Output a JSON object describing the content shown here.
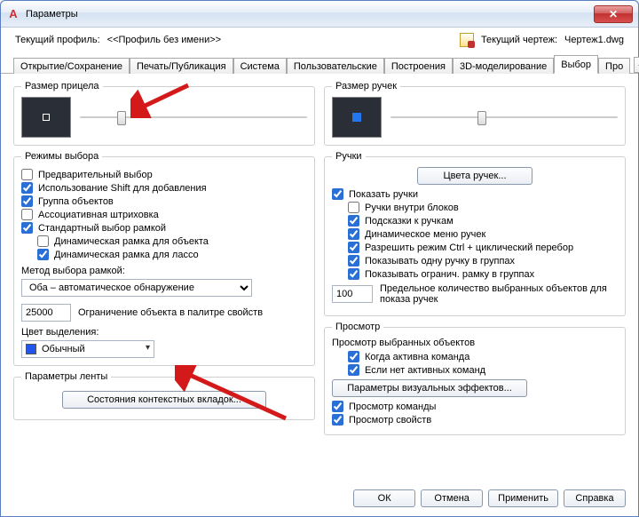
{
  "window": {
    "title": "Параметры"
  },
  "profile": {
    "label": "Текущий профиль:",
    "value": "<<Профиль без имени>>",
    "drawing_label": "Текущий чертеж:",
    "drawing_value": "Чертеж1.dwg"
  },
  "tabs": {
    "t0": "Открытие/Сохранение",
    "t1": "Печать/Публикация",
    "t2": "Система",
    "t3": "Пользовательские",
    "t4": "Построения",
    "t5": "3D-моделирование",
    "t6": "Выбор",
    "t7": "Про"
  },
  "left": {
    "pickbox": {
      "legend": "Размер прицела"
    },
    "modes": {
      "legend": "Режимы выбора",
      "c1": "Предварительный выбор",
      "c2": "Использование Shift для добавления",
      "c3": "Группа объектов",
      "c4": "Ассоциативная штриховка",
      "c5": "Стандартный выбор рамкой",
      "c6": "Динамическая рамка для объекта",
      "c7": "Динамическая рамка для лассо",
      "method_label": "Метод выбора рамкой:",
      "method_value": "Оба – автоматическое обнаружение",
      "limit_value": "25000",
      "limit_label": "Ограничение объекта в палитре свойств",
      "color_label": "Цвет выделения:",
      "color_value": "Обычный"
    },
    "ribbon": {
      "legend": "Параметры ленты",
      "btn": "Состояния контекстных вкладок..."
    }
  },
  "right": {
    "gripsize": {
      "legend": "Размер ручек"
    },
    "grips": {
      "legend": "Ручки",
      "colors_btn": "Цвета ручек...",
      "g1": "Показать ручки",
      "g2": "Ручки внутри блоков",
      "g3": "Подсказки к ручкам",
      "g4": "Динамическое меню ручек",
      "g5": "Разрешить режим Ctrl + циклический перебор",
      "g6": "Показывать одну ручку в группах",
      "g7": "Показывать огранич. рамку в группах",
      "objlimit_value": "100",
      "objlimit_label": "Предельное количество выбранных объектов для показа ручек"
    },
    "preview": {
      "legend": "Просмотр",
      "p_label": "Просмотр выбранных объектов",
      "p1": "Когда активна команда",
      "p2": "Если нет активных команд",
      "btn": "Параметры визуальных эффектов...",
      "p3": "Просмотр команды",
      "p4": "Просмотр свойств"
    }
  },
  "buttons": {
    "ok": "ОК",
    "cancel": "Отмена",
    "apply": "Применить",
    "help": "Справка"
  }
}
